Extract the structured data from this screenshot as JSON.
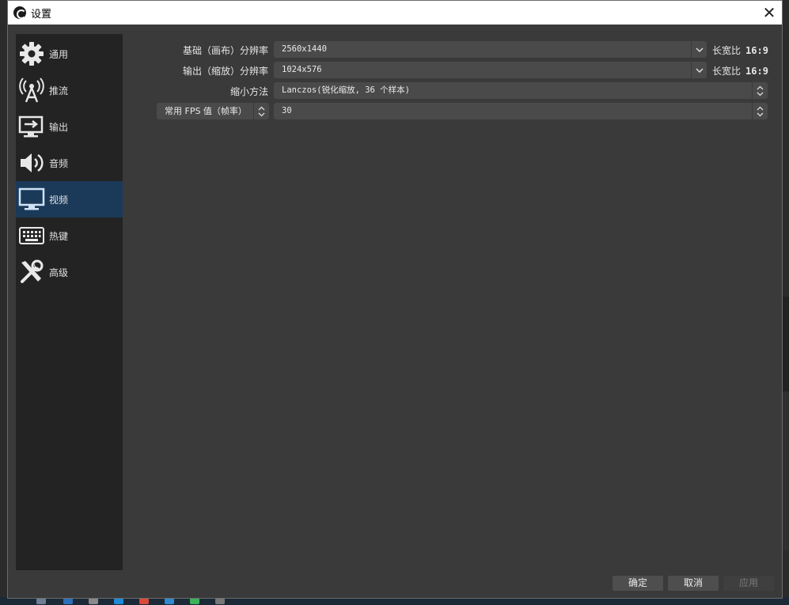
{
  "window": {
    "title": "设置",
    "close_glyph": "✕"
  },
  "sidebar": {
    "items": [
      {
        "label": "通用",
        "icon": "gear-icon",
        "active": false
      },
      {
        "label": "推流",
        "icon": "broadcast-antenna-icon",
        "active": false
      },
      {
        "label": "输出",
        "icon": "output-monitor-icon",
        "active": false
      },
      {
        "label": "音频",
        "icon": "speaker-icon",
        "active": false
      },
      {
        "label": "视频",
        "icon": "monitor-icon",
        "active": true
      },
      {
        "label": "热键",
        "icon": "keyboard-icon",
        "active": false
      },
      {
        "label": "高级",
        "icon": "tools-icon",
        "active": false
      }
    ]
  },
  "video": {
    "base_resolution_label": "基础（画布）分辨率",
    "base_resolution_value": "2560x1440",
    "base_aspect_label": "长宽比",
    "base_aspect_value": "16:9",
    "output_resolution_label": "输出（缩放）分辨率",
    "output_resolution_value": "1024x576",
    "output_aspect_label": "长宽比",
    "output_aspect_value": "16:9",
    "downscale_label": "缩小方法",
    "downscale_value": "Lanczos(锐化缩放, 36 个样本)",
    "fps_type_label": "常用 FPS 值（帧率）",
    "fps_value": "30"
  },
  "footer": {
    "ok_label": "确定",
    "cancel_label": "取消",
    "apply_label": "应用"
  },
  "colors": {
    "sidebar_active": "#1b3a5a",
    "sidebar_bg": "#232323",
    "content_bg": "#3a3a3a",
    "field_bg": "#4a4a4a"
  }
}
